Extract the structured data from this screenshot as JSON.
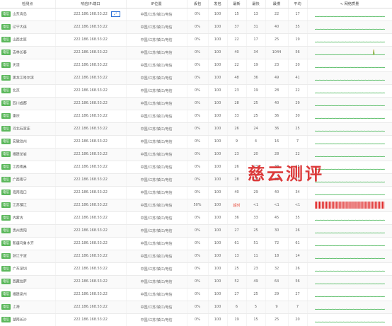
{
  "headers": {
    "node": "检测点",
    "ip_port": "响应IP:端口",
    "location": "IP位置",
    "status": "丢包",
    "sent": "发包",
    "min": "最新",
    "max": "最快",
    "slow": "最慢",
    "avg": "平均",
    "chart": "∿ 网络质量"
  },
  "tag_label": "电信",
  "watermark": "慈云测评",
  "colors": {
    "tag": "#5cb85c",
    "line": "#3fb34f",
    "loss": "#e02020",
    "timeout": "#e74c3c"
  },
  "rows": [
    {
      "city": "山东青岛",
      "ip": "222.186.168.53:22",
      "loc": "中国/江苏/镇江/电信",
      "loss": "0%",
      "sent": "100",
      "latest": "15",
      "fast": "13",
      "slowest": "22",
      "avg": "17",
      "flag": true,
      "spike": 0
    },
    {
      "city": "辽宁大连",
      "ip": "222.186.168.53:22",
      "loc": "中国/江苏/镇江/电信",
      "loss": "0%",
      "sent": "100",
      "latest": "37",
      "fast": "31",
      "slowest": "40",
      "avg": "35",
      "spike": 0
    },
    {
      "city": "山西太原",
      "ip": "222.186.168.53:22",
      "loc": "中国/江苏/镇江/电信",
      "loss": "0%",
      "sent": "100",
      "latest": "22",
      "fast": "17",
      "slowest": "25",
      "avg": "19",
      "spike": 0
    },
    {
      "city": "吉林长春",
      "ip": "222.186.168.53:22",
      "loc": "中国/江苏/镇江/电信",
      "loss": "0%",
      "sent": "100",
      "latest": "40",
      "fast": "34",
      "slowest": "1044",
      "avg": "56",
      "spike": 1
    },
    {
      "city": "天津",
      "ip": "222.186.168.53:22",
      "loc": "中国/江苏/镇江/电信",
      "loss": "0%",
      "sent": "100",
      "latest": "22",
      "fast": "19",
      "slowest": "23",
      "avg": "20",
      "spike": 0
    },
    {
      "city": "黑龙江哈尔滨",
      "ip": "222.186.168.53:22",
      "loc": "中国/江苏/镇江/电信",
      "loss": "0%",
      "sent": "100",
      "latest": "48",
      "fast": "36",
      "slowest": "49",
      "avg": "41",
      "spike": 0
    },
    {
      "city": "北京",
      "ip": "222.186.168.53:22",
      "loc": "中国/江苏/镇江/电信",
      "loss": "0%",
      "sent": "100",
      "latest": "23",
      "fast": "19",
      "slowest": "28",
      "avg": "22",
      "spike": 0
    },
    {
      "city": "四川成都",
      "ip": "222.186.168.53:22",
      "loc": "中国/江苏/镇江/电信",
      "loss": "0%",
      "sent": "100",
      "latest": "28",
      "fast": "25",
      "slowest": "40",
      "avg": "29",
      "spike": 0
    },
    {
      "city": "重庆",
      "ip": "222.186.168.53:22",
      "loc": "中国/江苏/镇江/电信",
      "loss": "0%",
      "sent": "100",
      "latest": "33",
      "fast": "25",
      "slowest": "36",
      "avg": "30",
      "spike": 0
    },
    {
      "city": "河北石家庄",
      "ip": "222.186.168.53:22",
      "loc": "中国/江苏/镇江/电信",
      "loss": "0%",
      "sent": "100",
      "latest": "26",
      "fast": "24",
      "slowest": "36",
      "avg": "25",
      "spike": 0
    },
    {
      "city": "安徽池州",
      "ip": "222.186.168.53:22",
      "loc": "中国/江苏/镇江/电信",
      "loss": "0%",
      "sent": "100",
      "latest": "9",
      "fast": "4",
      "slowest": "16",
      "avg": "7",
      "spike": 0
    },
    {
      "city": "福建龙岩",
      "ip": "222.186.168.53:22",
      "loc": "中国/江苏/镇江/电信",
      "loss": "0%",
      "sent": "100",
      "latest": "23",
      "fast": "20",
      "slowest": "28",
      "avg": "22",
      "spike": 0
    },
    {
      "city": "江西南昌",
      "ip": "222.186.168.53:22",
      "loc": "中国/江苏/镇江/电信",
      "loss": "0%",
      "sent": "100",
      "latest": "26",
      "fast": "23",
      "slowest": "38",
      "avg": "25",
      "spike": 0
    },
    {
      "city": "广西南宁",
      "ip": "222.186.168.53:22",
      "loc": "中国/江苏/镇江/电信",
      "loss": "0%",
      "sent": "100",
      "latest": "28",
      "fast": "24",
      "slowest": "35",
      "avg": "27",
      "spike": 0
    },
    {
      "city": "海南海口",
      "ip": "222.186.168.53:22",
      "loc": "中国/江苏/镇江/电信",
      "loss": "0%",
      "sent": "100",
      "latest": "40",
      "fast": "29",
      "slowest": "40",
      "avg": "34",
      "spike": 0
    },
    {
      "city": "江苏镇江",
      "ip": "222.186.168.53:22",
      "loc": "中国/江苏/镇江/电信",
      "loss": "50%",
      "sent": "100",
      "latest": "超时",
      "fast": "<1",
      "slowest": "<1",
      "avg": "<1",
      "timeout": true,
      "spike": 0
    },
    {
      "city": "内蒙古",
      "ip": "222.186.168.53:22",
      "loc": "中国/江苏/镇江/电信",
      "loss": "0%",
      "sent": "100",
      "latest": "36",
      "fast": "33",
      "slowest": "45",
      "avg": "35",
      "spike": 0
    },
    {
      "city": "贵州贵阳",
      "ip": "222.186.168.53:22",
      "loc": "中国/江苏/镇江/电信",
      "loss": "0%",
      "sent": "100",
      "latest": "27",
      "fast": "25",
      "slowest": "30",
      "avg": "26",
      "spike": 0
    },
    {
      "city": "新疆乌鲁木齐",
      "ip": "222.186.168.53:22",
      "loc": "中国/江苏/镇江/电信",
      "loss": "0%",
      "sent": "100",
      "latest": "61",
      "fast": "51",
      "slowest": "72",
      "avg": "61",
      "spike": 0
    },
    {
      "city": "浙江宁波",
      "ip": "222.186.168.53:22",
      "loc": "中国/江苏/镇江/电信",
      "loss": "0%",
      "sent": "100",
      "latest": "13",
      "fast": "11",
      "slowest": "18",
      "avg": "14",
      "spike": 0
    },
    {
      "city": "广东深圳",
      "ip": "222.186.168.53:22",
      "loc": "中国/江苏/镇江/电信",
      "loss": "0%",
      "sent": "100",
      "latest": "25",
      "fast": "23",
      "slowest": "32",
      "avg": "26",
      "spike": 0
    },
    {
      "city": "西藏拉萨",
      "ip": "222.186.168.53:22",
      "loc": "中国/江苏/镇江/电信",
      "loss": "0%",
      "sent": "100",
      "latest": "52",
      "fast": "49",
      "slowest": "64",
      "avg": "56",
      "spike": 0
    },
    {
      "city": "福建泉州",
      "ip": "222.186.168.53:22",
      "loc": "中国/江苏/镇江/电信",
      "loss": "0%",
      "sent": "100",
      "latest": "27",
      "fast": "25",
      "slowest": "29",
      "avg": "27",
      "spike": 0
    },
    {
      "city": "上海",
      "ip": "222.186.168.53:22",
      "loc": "中国/江苏/镇江/电信",
      "loss": "0%",
      "sent": "100",
      "latest": "6",
      "fast": "5",
      "slowest": "9",
      "avg": "7",
      "spike": 0
    },
    {
      "city": "湖南长沙",
      "ip": "222.186.168.53:22",
      "loc": "中国/江苏/镇江/电信",
      "loss": "0%",
      "sent": "100",
      "latest": "19",
      "fast": "15",
      "slowest": "25",
      "avg": "20",
      "spike": 0
    },
    {
      "city": "甘肃兰州",
      "ip": "222.186.168.53:22",
      "loc": "中国/江苏/镇江/电信",
      "loss": "0%",
      "sent": "100",
      "latest": "27",
      "fast": "25",
      "slowest": "47",
      "avg": "25",
      "spike": 0
    }
  ]
}
